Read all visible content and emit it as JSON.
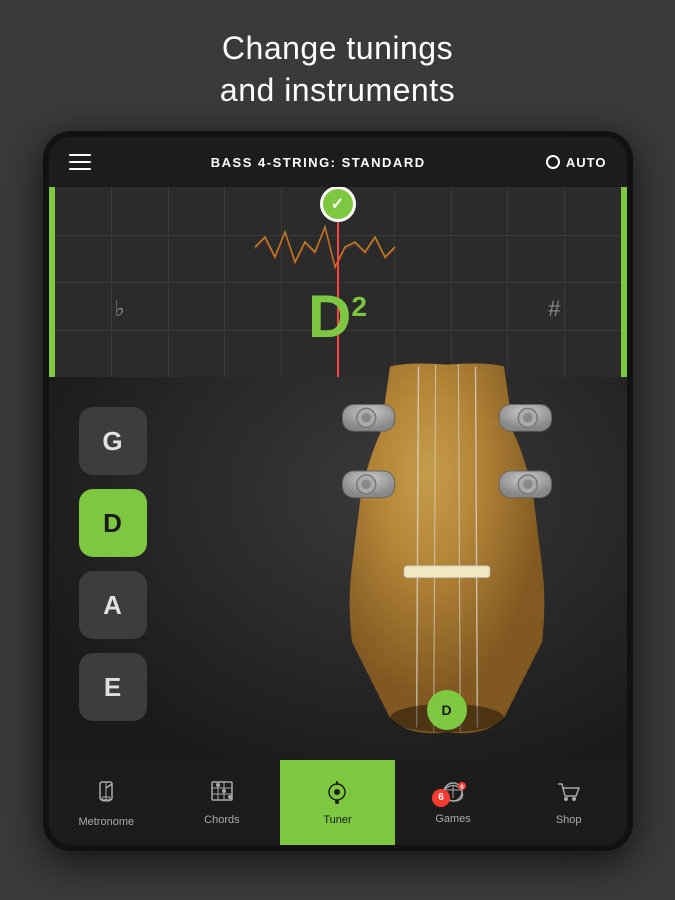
{
  "header": {
    "line1": "Change tunings",
    "line2": "and instruments"
  },
  "topbar": {
    "title": "BASS 4-STRING: STANDARD",
    "auto_label": "AUTO"
  },
  "tuner": {
    "note": "D",
    "octave": "2",
    "flat": "♭",
    "sharp": "#"
  },
  "strings": [
    {
      "note": "G",
      "active": false
    },
    {
      "note": "D",
      "active": true
    },
    {
      "note": "A",
      "active": false
    },
    {
      "note": "E",
      "active": false
    }
  ],
  "tuner_pin_note": "D",
  "nav": [
    {
      "id": "metronome",
      "label": "Metronome",
      "icon": "🎵",
      "active": false,
      "badge": null
    },
    {
      "id": "chords",
      "label": "Chords",
      "icon": "🎸",
      "active": false,
      "badge": null
    },
    {
      "id": "tuner",
      "label": "Tuner",
      "icon": "📍",
      "active": true,
      "badge": null
    },
    {
      "id": "games",
      "label": "Games",
      "icon": "🎮",
      "active": false,
      "badge": "6"
    },
    {
      "id": "shop",
      "label": "Shop",
      "icon": "🛒",
      "active": false,
      "badge": null
    }
  ]
}
